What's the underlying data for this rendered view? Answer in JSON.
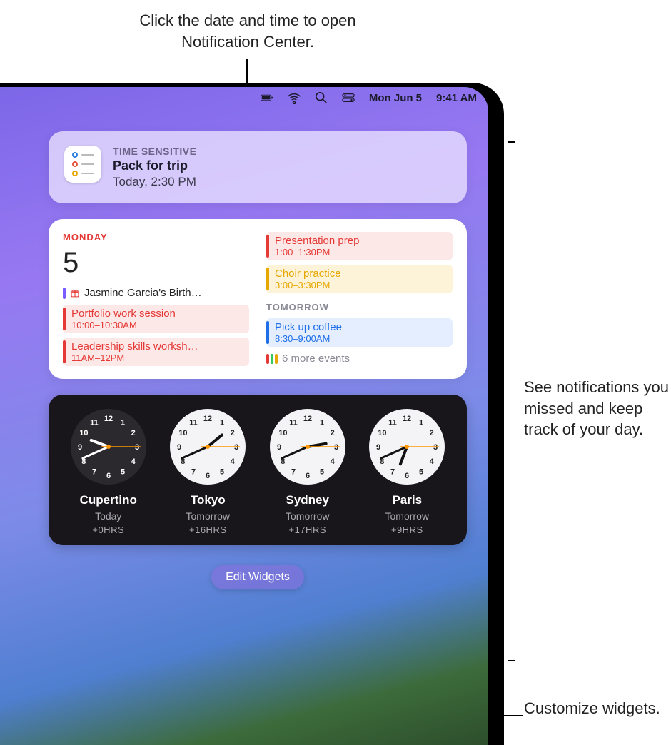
{
  "callouts": {
    "top": "Click the date and time to open Notification Center.",
    "right": "See notifications you missed and keep track of your day.",
    "bottom": "Customize widgets."
  },
  "menubar": {
    "date": "Mon Jun 5",
    "time": "9:41 AM"
  },
  "notification": {
    "category": "TIME SENSITIVE",
    "title": "Pack for trip",
    "subtitle": "Today, 2:30 PM"
  },
  "calendar": {
    "today_label": "MONDAY",
    "today_num": "5",
    "allday_title": "Jasmine Garcia's Birth…",
    "events_left": [
      {
        "title": "Portfolio work session",
        "time": "10:00–10:30AM",
        "color": "#e53935",
        "bg": "#fde8e8"
      },
      {
        "title": "Leadership skills worksh…",
        "time": "11AM–12PM",
        "color": "#e53935",
        "bg": "#fde8e8"
      }
    ],
    "events_right": [
      {
        "title": "Presentation prep",
        "time": "1:00–1:30PM",
        "color": "#e53935",
        "bg": "#fde8e8"
      },
      {
        "title": "Choir practice",
        "time": "3:00–3:30PM",
        "color": "#e6a700",
        "bg": "#fdf3d8"
      }
    ],
    "tomorrow_label": "TOMORROW",
    "tomorrow_events": [
      {
        "title": "Pick up coffee",
        "time": "8:30–9:00AM",
        "color": "#1e6ee8",
        "bg": "#e4eeff"
      }
    ],
    "more_label": "6 more events"
  },
  "clocks": [
    {
      "city": "Cupertino",
      "day": "Today",
      "offset": "+0HRS",
      "hour": 9,
      "minute": 41,
      "face": "dark"
    },
    {
      "city": "Tokyo",
      "day": "Tomorrow",
      "offset": "+16HRS",
      "hour": 1,
      "minute": 41,
      "face": "light"
    },
    {
      "city": "Sydney",
      "day": "Tomorrow",
      "offset": "+17HRS",
      "hour": 2,
      "minute": 41,
      "face": "light"
    },
    {
      "city": "Paris",
      "day": "Tomorrow",
      "offset": "+9HRS",
      "hour": 6,
      "minute": 41,
      "face": "light"
    }
  ],
  "edit_widgets_label": "Edit Widgets"
}
